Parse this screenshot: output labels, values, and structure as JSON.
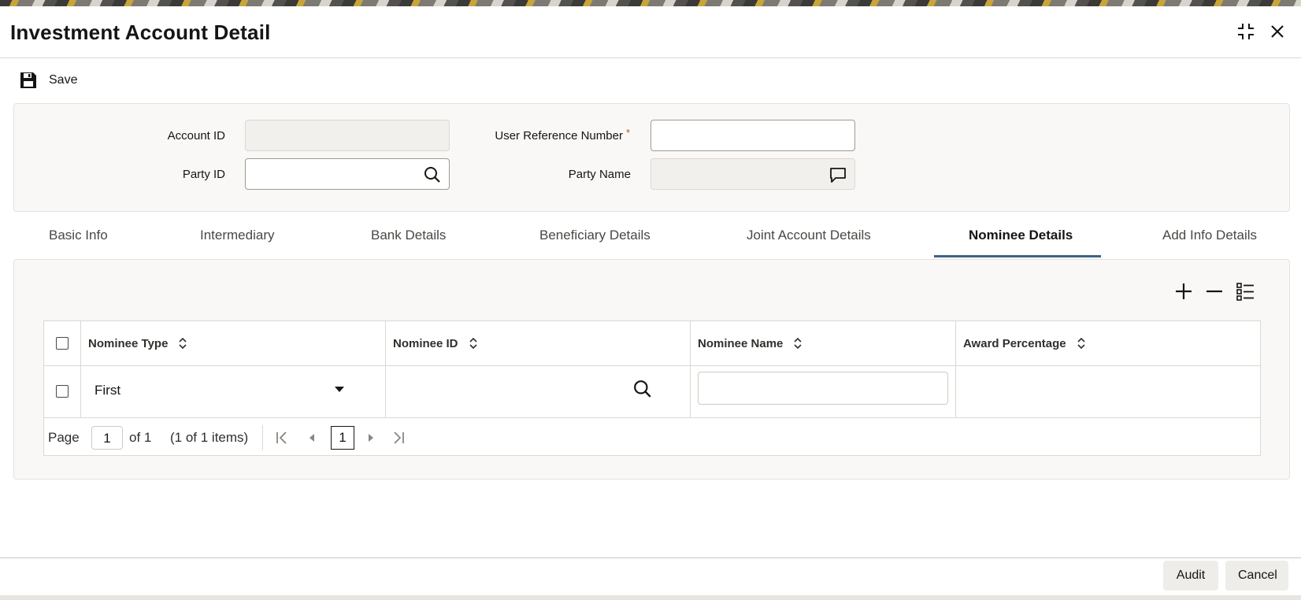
{
  "window": {
    "title": "Investment Account Detail",
    "maximize_icon": "maximize-icon",
    "close_icon": "close-icon"
  },
  "toolbar": {
    "save_label": "Save",
    "save_icon": "floppy-disk-icon"
  },
  "form": {
    "account_id_label": "Account ID",
    "account_id_value": "",
    "user_ref_label": "User Reference Number",
    "user_ref_required": "*",
    "user_ref_value": "",
    "party_id_label": "Party ID",
    "party_id_value": "",
    "party_name_label": "Party Name",
    "party_name_value": ""
  },
  "tabs": [
    {
      "label": "Basic Info"
    },
    {
      "label": "Intermediary"
    },
    {
      "label": "Bank Details"
    },
    {
      "label": "Beneficiary Details"
    },
    {
      "label": "Joint Account Details"
    },
    {
      "label": "Nominee Details",
      "active": true
    },
    {
      "label": "Add Info Details"
    }
  ],
  "grid": {
    "toolbar_icons": [
      "add-icon",
      "remove-icon",
      "single-record-view-icon"
    ],
    "columns": [
      "Nominee Type",
      "Nominee ID",
      "Nominee Name",
      "Award Percentage"
    ],
    "rows": [
      {
        "nominee_type": "First",
        "nominee_id": "",
        "nominee_name": "",
        "award_percentage": ""
      }
    ]
  },
  "pager": {
    "page_label": "Page",
    "page_value": "1",
    "of_text": "of 1",
    "items_text": "(1 of 1 items)",
    "current_page": "1"
  },
  "footer": {
    "audit_label": "Audit",
    "cancel_label": "Cancel"
  },
  "colors": {
    "tab_accent": "#3e6287",
    "required": "#c74634",
    "panel_bg": "#f9f8f6"
  }
}
